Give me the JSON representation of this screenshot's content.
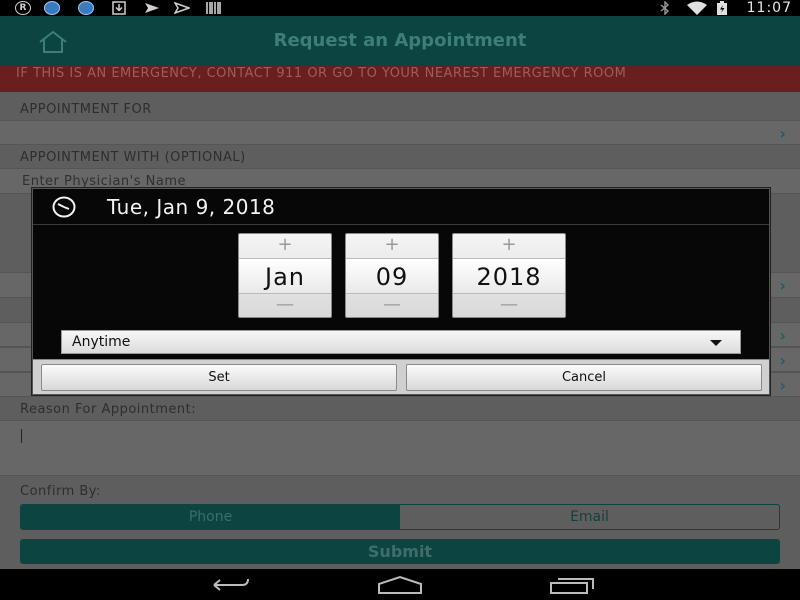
{
  "statusbar": {
    "time": "11:07",
    "icons": [
      "registered-icon",
      "app-notification-icon",
      "app-notification-icon",
      "download-icon",
      "send-icon",
      "send-icon",
      "barcode-icon",
      "bluetooth-icon",
      "wifi-icon",
      "battery-charging-icon"
    ]
  },
  "header": {
    "title": "Request an Appointment",
    "home_icon": "home-icon"
  },
  "emergency": {
    "text": "IF THIS IS AN EMERGENCY, CONTACT 911 OR GO TO YOUR NEAREST EMERGENCY ROOM"
  },
  "form": {
    "appointment_for_label": "APPOINTMENT FOR",
    "appointment_with_label": "APPOINTMENT WITH (OPTIONAL)",
    "physician_placeholder": "Enter Physician's Name",
    "reason_label": "Reason For Appointment:",
    "confirm_label": "Confirm By:",
    "confirm_options": [
      "Phone",
      "Email"
    ],
    "confirm_selected": "Phone",
    "submit_label": "Submit"
  },
  "dialog": {
    "title": "Tue, Jan 9, 2018",
    "month": "Jan",
    "day": "09",
    "year": "2018",
    "time_select": "Anytime",
    "set_label": "Set",
    "cancel_label": "Cancel",
    "plus": "+",
    "minus": "—"
  },
  "colors": {
    "header_bg": "#0b4440",
    "emergency_bg": "#6a1f1f",
    "accent": "#1b5e70"
  }
}
